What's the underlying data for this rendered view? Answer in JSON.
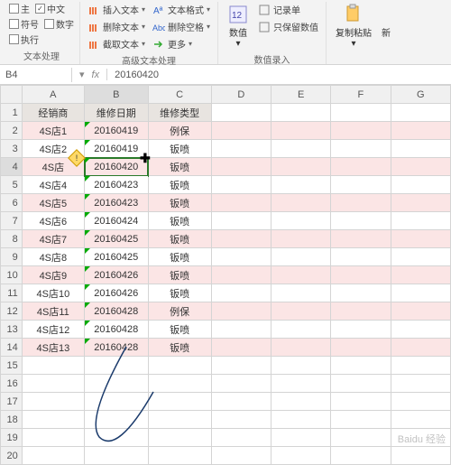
{
  "ribbon": {
    "grp1": {
      "label": "文本处理",
      "chks": [
        "主",
        "中文",
        "符号",
        "数字",
        "执行"
      ],
      "chk_checked": "中文"
    },
    "grp2": {
      "label": "高级文本处理",
      "btns": {
        "insert": "插入文本",
        "del": "删除文本",
        "cut": "截取文本",
        "fmt": "文本格式",
        "delspace": "删除空格",
        "more": "更多"
      }
    },
    "grp3": {
      "label": "数值录入",
      "btns": {
        "num": "数值",
        "rec": "记录单",
        "keep": "只保留数值"
      }
    },
    "grp4": {
      "btns": {
        "paste": "复制粘贴",
        "new": "新"
      }
    }
  },
  "formula": {
    "name": "B4",
    "fx": "fx",
    "value": "20160420"
  },
  "cols": [
    "A",
    "B",
    "C",
    "D",
    "E",
    "F",
    "G"
  ],
  "header_row": {
    "a": "经销商",
    "b": "维修日期",
    "c": "维修类型"
  },
  "rows": [
    {
      "n": 1,
      "pink": false,
      "hdr": true
    },
    {
      "n": 2,
      "pink": true,
      "a": "4S店1",
      "b": "20160419",
      "c": "例保"
    },
    {
      "n": 3,
      "pink": false,
      "a": "4S店2",
      "b": "20160419",
      "c": "钣喷"
    },
    {
      "n": 4,
      "pink": true,
      "a": "4S店",
      "b": "20160420",
      "c": "钣喷",
      "sel": true,
      "warn": true
    },
    {
      "n": 5,
      "pink": false,
      "a": "4S店4",
      "b": "20160423",
      "c": "钣喷"
    },
    {
      "n": 6,
      "pink": true,
      "a": "4S店5",
      "b": "20160423",
      "c": "钣喷"
    },
    {
      "n": 7,
      "pink": false,
      "a": "4S店6",
      "b": "20160424",
      "c": "钣喷"
    },
    {
      "n": 8,
      "pink": true,
      "a": "4S店7",
      "b": "20160425",
      "c": "钣喷"
    },
    {
      "n": 9,
      "pink": false,
      "a": "4S店8",
      "b": "20160425",
      "c": "钣喷"
    },
    {
      "n": 10,
      "pink": true,
      "a": "4S店9",
      "b": "20160426",
      "c": "钣喷"
    },
    {
      "n": 11,
      "pink": false,
      "a": "4S店10",
      "b": "20160426",
      "c": "钣喷"
    },
    {
      "n": 12,
      "pink": true,
      "a": "4S店11",
      "b": "20160428",
      "c": "例保"
    },
    {
      "n": 13,
      "pink": false,
      "a": "4S店12",
      "b": "20160428",
      "c": "钣喷"
    },
    {
      "n": 14,
      "pink": true,
      "a": "4S店13",
      "b": "20160428",
      "c": "钣喷"
    },
    {
      "n": 15,
      "pink": false,
      "a": "",
      "b": "",
      "c": ""
    },
    {
      "n": 16,
      "pink": false,
      "a": "",
      "b": "",
      "c": ""
    },
    {
      "n": 17,
      "pink": false,
      "a": "",
      "b": "",
      "c": ""
    },
    {
      "n": 18,
      "pink": false,
      "a": "",
      "b": "",
      "c": ""
    },
    {
      "n": 19,
      "pink": false,
      "a": "",
      "b": "",
      "c": ""
    },
    {
      "n": 20,
      "pink": false,
      "a": "",
      "b": "",
      "c": ""
    }
  ],
  "watermark": "Baidu 经验"
}
